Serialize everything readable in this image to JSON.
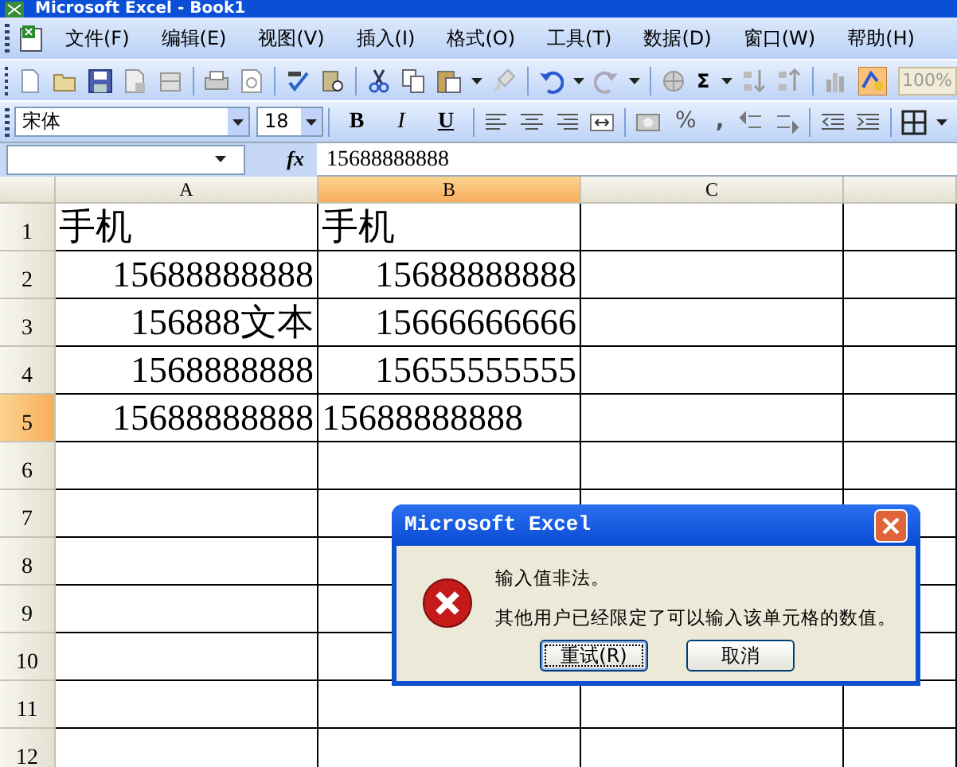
{
  "window": {
    "title": "Microsoft Excel - Book1"
  },
  "menu": [
    {
      "label": "文件(F)"
    },
    {
      "label": "编辑(E)"
    },
    {
      "label": "视图(V)"
    },
    {
      "label": "插入(I)"
    },
    {
      "label": "格式(O)"
    },
    {
      "label": "工具(T)"
    },
    {
      "label": "数据(D)"
    },
    {
      "label": "窗口(W)"
    },
    {
      "label": "帮助(H)"
    }
  ],
  "standard_toolbar": {
    "autosum": "Σ",
    "zoom": "100%"
  },
  "formatting_toolbar": {
    "font": "宋体",
    "size": "18",
    "styles": [
      {
        "label": "B",
        "kind": "bold"
      },
      {
        "label": "I",
        "kind": "italic"
      },
      {
        "label": "U",
        "kind": "underline"
      }
    ],
    "percent": "%",
    "comma": ","
  },
  "formula_bar": {
    "fx": "fx",
    "value": "15688888888"
  },
  "sheet": {
    "columns": [
      {
        "label": "A",
        "selected": false
      },
      {
        "label": "B",
        "selected": true
      },
      {
        "label": "C",
        "selected": false
      }
    ],
    "rows": [
      {
        "label": "1",
        "selected": false,
        "cells": [
          {
            "text": "手机",
            "kind": "text"
          },
          {
            "text": "手机",
            "kind": "text"
          }
        ]
      },
      {
        "label": "2",
        "selected": false,
        "cells": [
          {
            "text": "15688888888",
            "kind": "number"
          },
          {
            "text": "15688888888",
            "kind": "number"
          }
        ]
      },
      {
        "label": "3",
        "selected": false,
        "cells": [
          {
            "text": "156888文本",
            "kind": "number"
          },
          {
            "text": "15666666666",
            "kind": "number"
          }
        ]
      },
      {
        "label": "4",
        "selected": false,
        "cells": [
          {
            "text": "1568888888",
            "kind": "number"
          },
          {
            "text": "15655555555",
            "kind": "number"
          }
        ]
      },
      {
        "label": "5",
        "selected": true,
        "cells": [
          {
            "text": "15688888888",
            "kind": "number"
          },
          {
            "text": "15688888888",
            "kind": "text"
          }
        ]
      },
      {
        "label": "6",
        "selected": false
      },
      {
        "label": "7",
        "selected": false
      },
      {
        "label": "8",
        "selected": false
      },
      {
        "label": "9",
        "selected": false
      },
      {
        "label": "10",
        "selected": false
      },
      {
        "label": "11",
        "selected": false
      },
      {
        "label": "12",
        "selected": false
      }
    ]
  },
  "dialog": {
    "title": "Microsoft Excel",
    "messages": [
      "输入值非法。",
      "其他用户已经限定了可以输入该单元格的数值。"
    ],
    "buttons": [
      {
        "label": "重试(R)",
        "default": true
      },
      {
        "label": "取消",
        "default": false
      }
    ]
  }
}
